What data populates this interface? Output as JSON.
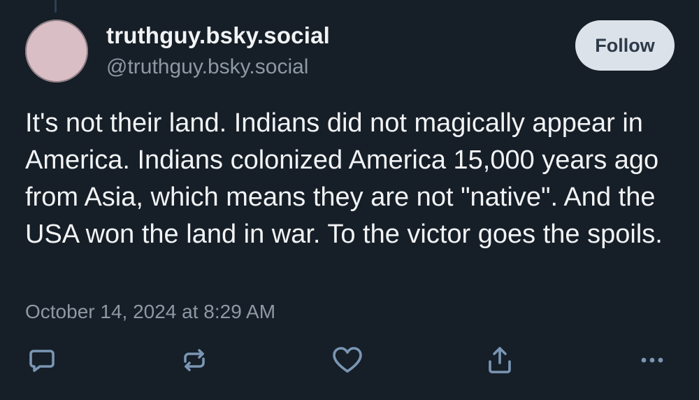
{
  "post": {
    "author": {
      "display_name": "truthguy.bsky.social",
      "handle": "@truthguy.bsky.social"
    },
    "follow_label": "Follow",
    "text": "It's not their land. Indians did not magically appear in America. Indians colonized America 15,000 years ago from Asia, which means they are not \"native\". And the USA won the land in war. To the victor goes the spoils.",
    "timestamp": "October 14, 2024 at 8:29 AM"
  },
  "actions": {
    "icons": [
      "reply-icon",
      "repost-icon",
      "like-icon",
      "share-icon",
      "more-options-icon"
    ]
  },
  "colors": {
    "background": "#161e27",
    "text": "#f1f3f5",
    "muted": "#8d99a5",
    "follow_button_bg": "#dce2ea",
    "follow_button_text": "#2c3a49",
    "action_icon": "#7a96b4"
  }
}
